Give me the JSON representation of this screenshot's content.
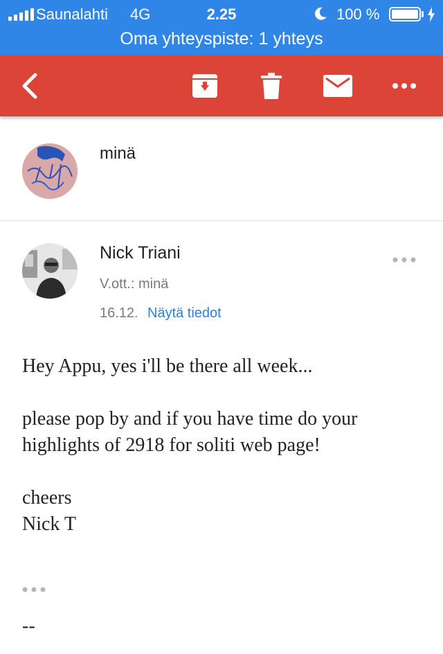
{
  "status_bar": {
    "carrier": "Saunalahti",
    "network": "4G",
    "time": "2.25",
    "battery": "100 %",
    "battery_level": 1.0,
    "hotspot_text": "Oma yhteyspiste: 1 yhteys"
  },
  "toolbar": {
    "icons": [
      "back-arrow-icon",
      "archive-icon",
      "trash-icon",
      "mail-icon",
      "more-horizontal-icon"
    ]
  },
  "thread": {
    "self_message": {
      "sender": "minä"
    },
    "message": {
      "sender": "Nick Triani",
      "to": "V.ott.: minä",
      "date": "16.12.",
      "details_link": "Näytä tiedot",
      "body": {
        "line1": "Hey Appu, yes i'll be there all week...",
        "line2": "please pop by and if you have time do your highlights of 2918 for soliti web page!",
        "line3": "cheers",
        "line4": "Nick T"
      },
      "signature_separator": "--"
    }
  },
  "colors": {
    "status_bar": "#2f86e6",
    "toolbar": "#db4437",
    "link": "#2f7fe0"
  }
}
